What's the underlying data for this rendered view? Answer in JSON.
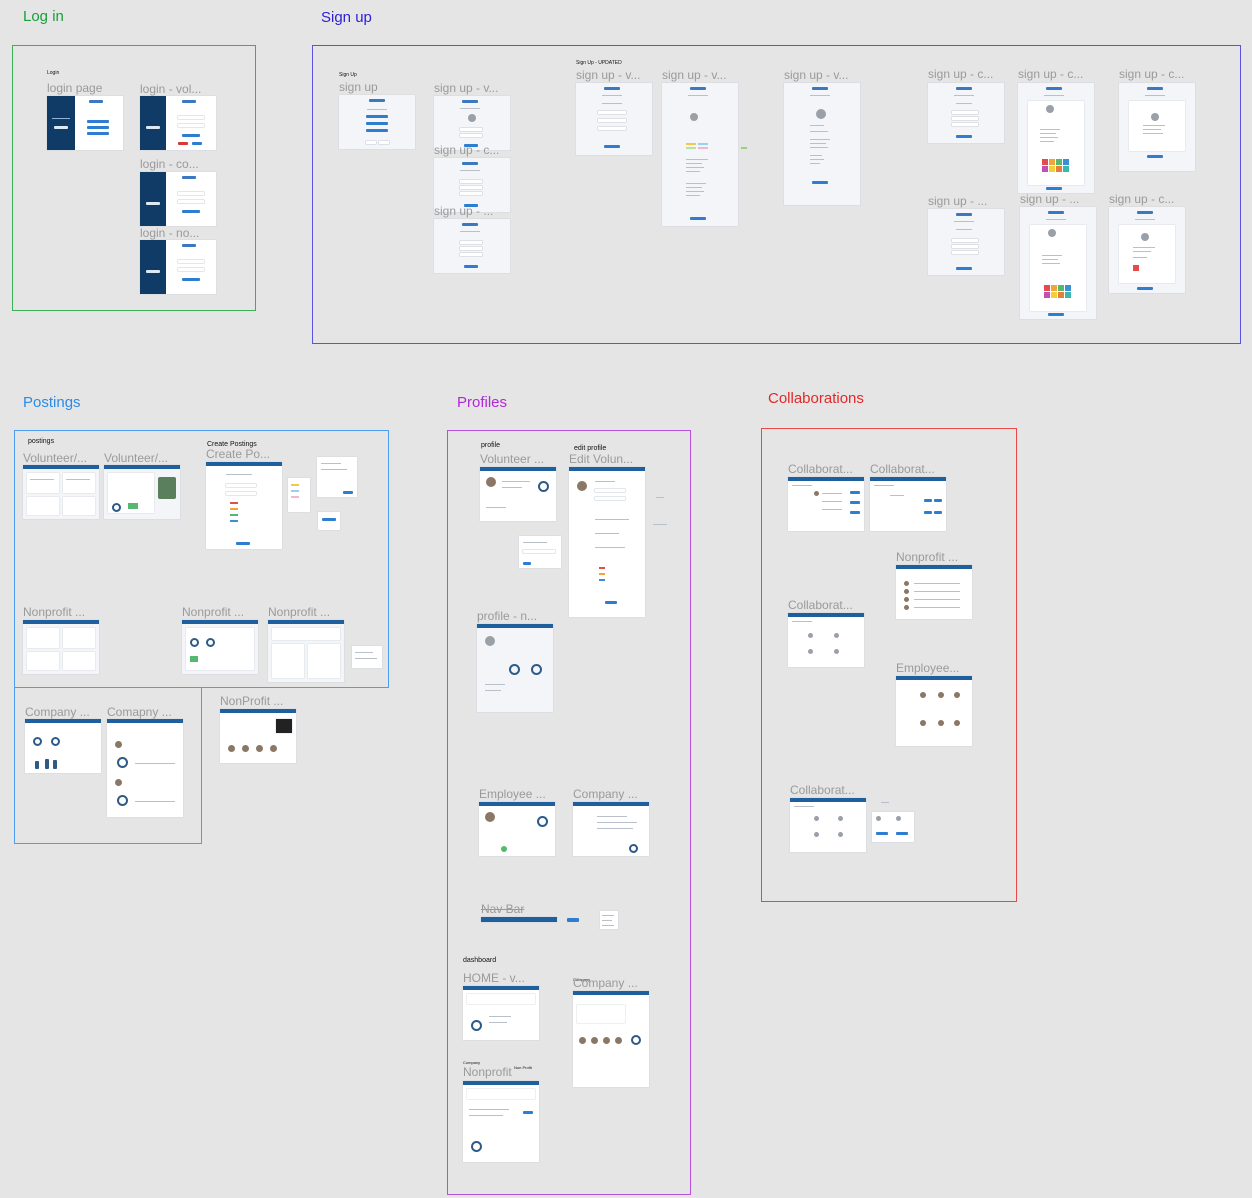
{
  "sections": {
    "login": {
      "title": "Log in",
      "color": "#1a9e3c"
    },
    "signup": {
      "title": "Sign up",
      "color": "#2c1fd6"
    },
    "postings": {
      "title": "Postings",
      "color": "#2b8be6"
    },
    "profiles": {
      "title": "Profiles",
      "color": "#b128d8"
    },
    "collaborations": {
      "title": "Collaborations",
      "color": "#e02a2a"
    }
  },
  "small_labels": {
    "login_group": "Login",
    "signup_group": "Sign Up",
    "signup_updated": "Sign Up - UPDATED",
    "postings_group": "postings",
    "create_postings": "Create Postings",
    "profile_group": "profile",
    "edit_profile": "edit profile",
    "dashboard": "dashboard",
    "company_small": "Company",
    "nonprofit_small": "Non Profit"
  },
  "frames": {
    "login_page": "login page",
    "login_vol": "login - vol...",
    "login_co": "login - co...",
    "login_no": "login - no...",
    "sign_up": "sign up",
    "sign_up_v1": "sign up - v...",
    "sign_up_c1": "sign up - c...",
    "sign_up_dots1": "sign up - ...",
    "sign_up_v2": "sign up - v...",
    "sign_up_v3": "sign up - v...",
    "sign_up_v4": "sign up - v...",
    "sign_up_c2": "sign up - c...",
    "sign_up_c3": "sign up - c...",
    "sign_up_c4": "sign up - c...",
    "sign_up_dots2": "sign up - ...",
    "sign_up_dots3": "sign up - ...",
    "sign_up_c5": "sign up - c...",
    "volunteer_1": "Volunteer/...",
    "volunteer_2": "Volunteer/...",
    "create_po": "Create Po...",
    "nonprofit_p1": "Nonprofit ...",
    "nonprofit_p2": "Nonprofit ...",
    "nonprofit_p3": "Nonprofit ...",
    "company_1": "Company ...",
    "comapny_2": "Comapny ...",
    "nonprofit_p4": "NonProfit ...",
    "volunteer_profile": "Volunteer ...",
    "edit_volun": "Edit Volun...",
    "profile_n": "profile - n...",
    "employee_profile": "Employee ...",
    "company_profile": "Company ...",
    "nav_bar": "Nav Bar",
    "home_v": "HOME - v...",
    "company_dash": "Company ...",
    "nonprofit_dash": "Nonprofit",
    "collab_1": "Collaborat...",
    "collab_2": "Collaborat...",
    "nonprofit_c": "Nonprofit ...",
    "collab_3": "Collaborat...",
    "employee_c": "Employee...",
    "collab_4": "Collaborat..."
  }
}
